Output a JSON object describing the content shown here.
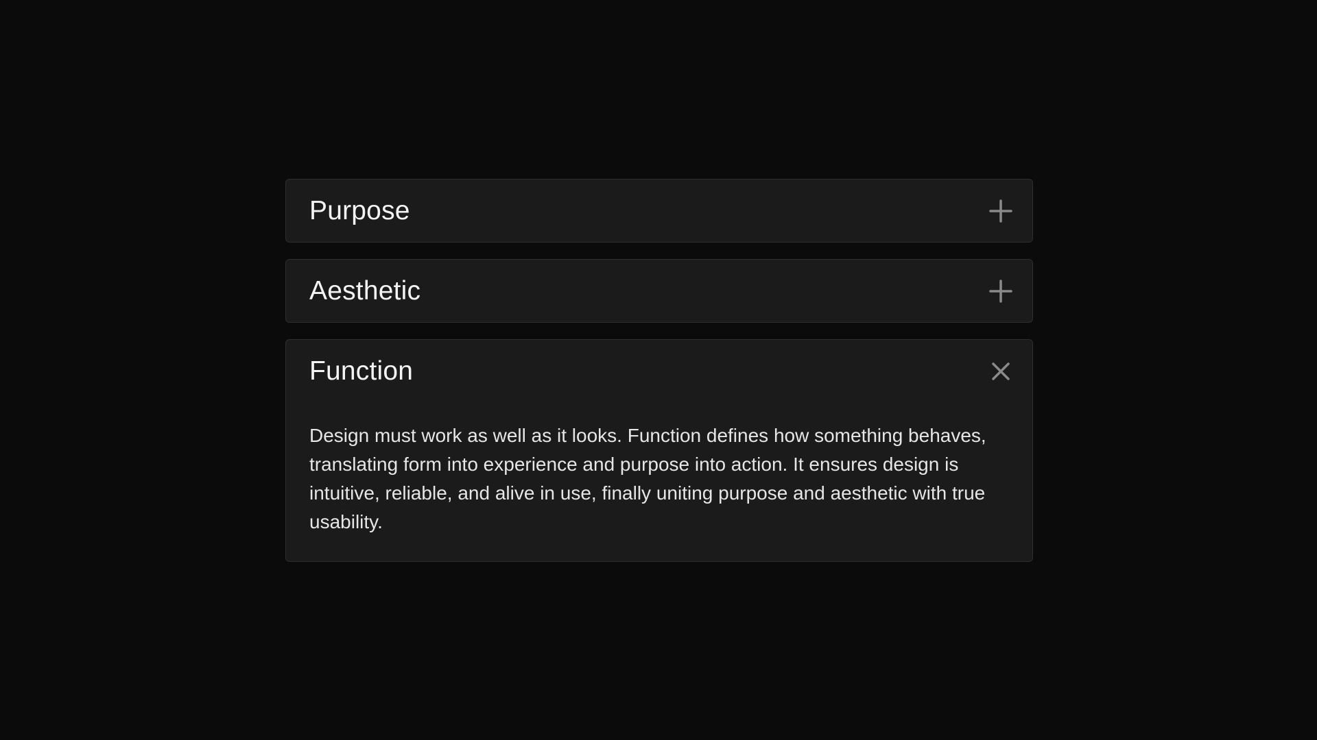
{
  "accordion": {
    "items": [
      {
        "title": "Purpose",
        "state": "collapsed",
        "icon": "plus-icon"
      },
      {
        "title": "Aesthetic",
        "state": "collapsed",
        "icon": "plus-icon"
      },
      {
        "title": "Function",
        "state": "expanded",
        "icon": "close-icon",
        "body": "Design must work as well as it looks. Function defines how something behaves, translating form into experience and purpose into action. It ensures design is intuitive, reliable, and alive in use, finally uniting purpose and aesthetic with true usability."
      }
    ]
  },
  "colors": {
    "background": "#0b0b0b",
    "panel": "#1b1b1b",
    "border": "#2e2e2e",
    "text": "#f4f4f4",
    "icon": "#8a8a8a"
  }
}
